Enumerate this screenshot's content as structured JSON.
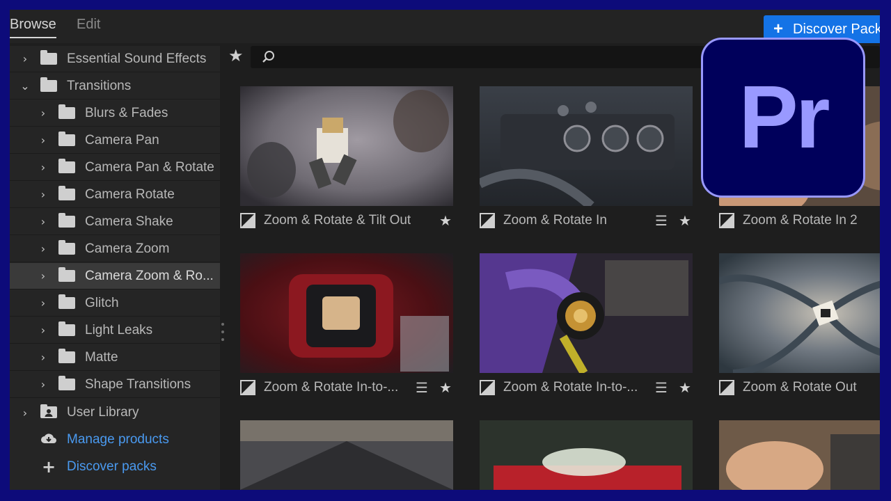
{
  "tabs": {
    "browse": "Browse",
    "edit": "Edit"
  },
  "discover_button": {
    "label": "Discover Packs"
  },
  "sidebar": {
    "items": [
      {
        "label": "Essential Sound Effects"
      },
      {
        "label": "Transitions"
      },
      {
        "label": "Blurs & Fades"
      },
      {
        "label": "Camera Pan"
      },
      {
        "label": "Camera Pan & Rotate"
      },
      {
        "label": "Camera Rotate"
      },
      {
        "label": "Camera Shake"
      },
      {
        "label": "Camera Zoom"
      },
      {
        "label": "Camera Zoom & Ro..."
      },
      {
        "label": "Glitch"
      },
      {
        "label": "Light Leaks"
      },
      {
        "label": "Matte"
      },
      {
        "label": "Shape Transitions"
      },
      {
        "label": "User Library"
      }
    ],
    "manage_products": "Manage products",
    "discover_packs": "Discover packs"
  },
  "grid": {
    "cards": [
      {
        "title": "Zoom & Rotate & Tilt Out"
      },
      {
        "title": "Zoom & Rotate In"
      },
      {
        "title": "Zoom & Rotate In 2"
      },
      {
        "title": "Zoom & Rotate In-to-..."
      },
      {
        "title": "Zoom & Rotate In-to-..."
      },
      {
        "title": "Zoom & Rotate Out"
      }
    ]
  },
  "logo": {
    "text": "Pr"
  },
  "colors": {
    "accent": "#1473e6",
    "link": "#4a9af0",
    "brand_bg": "#00005b",
    "brand_fg": "#9999ff"
  }
}
